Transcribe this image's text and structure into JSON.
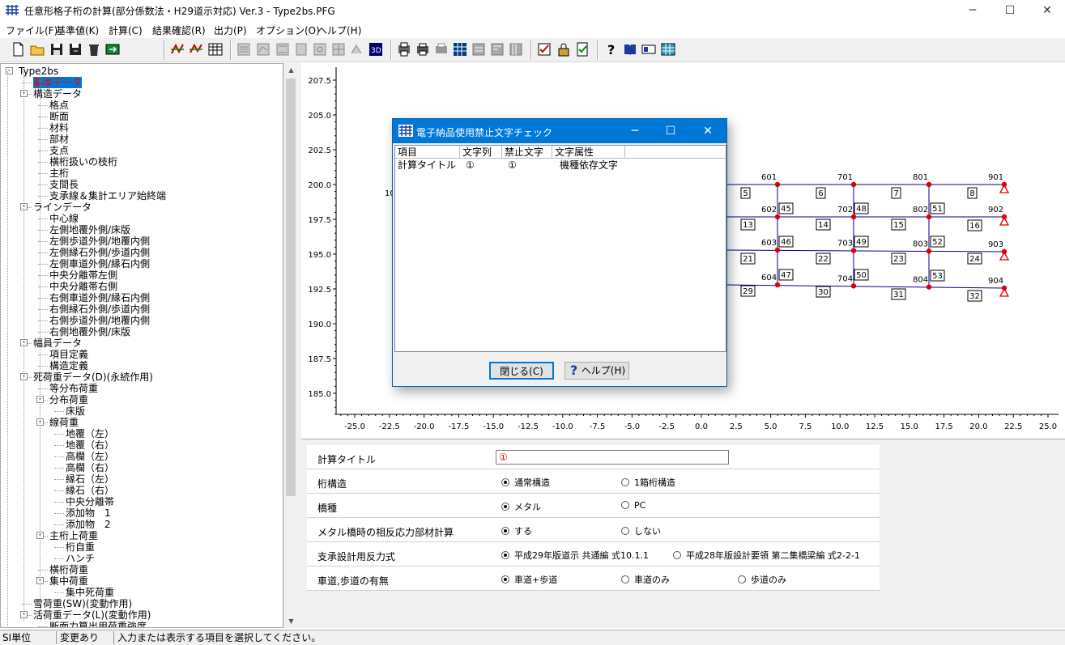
{
  "window": {
    "title": "任意形格子桁の計算(部分係数法・H29道示対応) Ver.3 - Type2bs.PFG",
    "min": "─",
    "max": "☐",
    "close": "✕"
  },
  "menu": [
    "ファイル(F)",
    "基準値(K)",
    "計算(C)",
    "結果確認(R)",
    "出力(P)",
    "オプション(O)",
    "ヘルプ(H)"
  ],
  "tree": [
    {
      "label": "Type2bs",
      "level": 0,
      "exp": "-"
    },
    {
      "label": "基本データ",
      "level": 1,
      "sel": true
    },
    {
      "label": "構造データ",
      "level": 1,
      "exp": "-"
    },
    {
      "label": "格点",
      "level": 2
    },
    {
      "label": "断面",
      "level": 2
    },
    {
      "label": "材料",
      "level": 2
    },
    {
      "label": "部材",
      "level": 2
    },
    {
      "label": "支点",
      "level": 2
    },
    {
      "label": "横桁扱いの枝桁",
      "level": 2
    },
    {
      "label": "主桁",
      "level": 2
    },
    {
      "label": "支間長",
      "level": 2
    },
    {
      "label": "支承線＆集計エリア始終端",
      "level": 2
    },
    {
      "label": "ラインデータ",
      "level": 1,
      "exp": "-"
    },
    {
      "label": "中心線",
      "level": 2
    },
    {
      "label": "左側地覆外側/床版",
      "level": 2
    },
    {
      "label": "左側歩道外側/地覆内側",
      "level": 2
    },
    {
      "label": "左側縁石外側/歩道内側",
      "level": 2
    },
    {
      "label": "左側車道外側/縁石内側",
      "level": 2
    },
    {
      "label": "中央分離帯左側",
      "level": 2
    },
    {
      "label": "中央分離帯右側",
      "level": 2
    },
    {
      "label": "右側車道外側/縁石内側",
      "level": 2
    },
    {
      "label": "右側縁石外側/歩道内側",
      "level": 2
    },
    {
      "label": "右側歩道外側/地覆内側",
      "level": 2
    },
    {
      "label": "右側地覆外側/床版",
      "level": 2
    },
    {
      "label": "幅員データ",
      "level": 1,
      "exp": "-"
    },
    {
      "label": "項目定義",
      "level": 2
    },
    {
      "label": "構造定義",
      "level": 2
    },
    {
      "label": "死荷重データ(D)(永続作用)",
      "level": 1,
      "exp": "-"
    },
    {
      "label": "等分布荷重",
      "level": 2
    },
    {
      "label": "分布荷重",
      "level": 2,
      "exp": "-"
    },
    {
      "label": "床版",
      "level": 3
    },
    {
      "label": "線荷重",
      "level": 2,
      "exp": "-"
    },
    {
      "label": "地覆（左）",
      "level": 3
    },
    {
      "label": "地覆（右）",
      "level": 3
    },
    {
      "label": "高欄（左）",
      "level": 3
    },
    {
      "label": "高欄（右）",
      "level": 3
    },
    {
      "label": "縁石（左）",
      "level": 3
    },
    {
      "label": "縁石（右）",
      "level": 3
    },
    {
      "label": "中央分離帯",
      "level": 3
    },
    {
      "label": "添加物　1",
      "level": 3
    },
    {
      "label": "添加物　2",
      "level": 3
    },
    {
      "label": "主桁上荷重",
      "level": 2,
      "exp": "-"
    },
    {
      "label": "桁自重",
      "level": 3
    },
    {
      "label": "ハンチ",
      "level": 3
    },
    {
      "label": "横桁荷重",
      "level": 2
    },
    {
      "label": "集中荷重",
      "level": 2,
      "exp": "-"
    },
    {
      "label": "集中死荷重",
      "level": 3
    },
    {
      "label": "雪荷重(SW)(変動作用)",
      "level": 1
    },
    {
      "label": "活荷重データ(L)(変動作用)",
      "level": 1,
      "exp": "-"
    },
    {
      "label": "断面力算出用荷重強度",
      "level": 2
    }
  ],
  "chart": {
    "yticks": [
      "207.5",
      "205.0",
      "202.5",
      "200.0",
      "197.5",
      "195.0",
      "192.5",
      "190.0",
      "187.5",
      "185.0"
    ],
    "xticks": [
      "-25.0",
      "-22.5",
      "-20.0",
      "-17.5",
      "-15.0",
      "-12.5",
      "-10.0",
      "-7.5",
      "-5.0",
      "-2.5",
      "0.0",
      "2.5",
      "5.0",
      "7.5",
      "10.0",
      "12.5",
      "15.0",
      "17.5",
      "20.0",
      "22.5",
      "25.0"
    ],
    "partial_label": "10",
    "node_labels": [
      "601",
      "701",
      "801",
      "901",
      "602",
      "702",
      "802",
      "902",
      "603",
      "703",
      "803",
      "903",
      "604",
      "704",
      "804",
      "904"
    ],
    "member_labels": [
      "5",
      "6",
      "7",
      "8",
      "13",
      "45",
      "14",
      "48",
      "15",
      "51",
      "16",
      "21",
      "46",
      "22",
      "49",
      "23",
      "52",
      "24",
      "29",
      "47",
      "30",
      "50",
      "31",
      "53",
      "32"
    ]
  },
  "dialog": {
    "title": "電子納品使用禁止文字チェック",
    "columns": [
      "項目",
      "文字列",
      "禁止文字",
      "文字属性"
    ],
    "rows": [
      [
        "計算タイトル",
        "①",
        "①",
        "機種依存文字"
      ]
    ],
    "close_label": "閉じる(C)",
    "help_label": "ヘルプ(H)",
    "help_icon": "?"
  },
  "props": {
    "title_label": "計算タイトル",
    "title_value": "①",
    "rows": [
      {
        "label": "桁構造",
        "options": [
          "通常構造",
          "1箱桁構造"
        ],
        "selected": 0
      },
      {
        "label": "橋種",
        "options": [
          "メタル",
          "PC"
        ],
        "selected": 0
      },
      {
        "label": "メタル橋時の相反応力部材計算",
        "options": [
          "する",
          "しない"
        ],
        "selected": 0
      },
      {
        "label": "支承設計用反力式",
        "options": [
          "平成29年版道示 共通編 式10.1.1",
          "平成28年版設計要領 第二集橋梁編 式2-2-1"
        ],
        "selected": 0
      },
      {
        "label": "車道,歩道の有無",
        "options": [
          "車道+歩道",
          "車道のみ",
          "歩道のみ"
        ],
        "selected": 0
      }
    ]
  },
  "status": [
    "SI単位",
    "変更あり",
    "入力または表示する項目を選択してください。"
  ],
  "colors": {
    "selection": "#0078d7",
    "dialog_title": "#0078d7",
    "node": "#e00000",
    "line": "#00008b"
  }
}
